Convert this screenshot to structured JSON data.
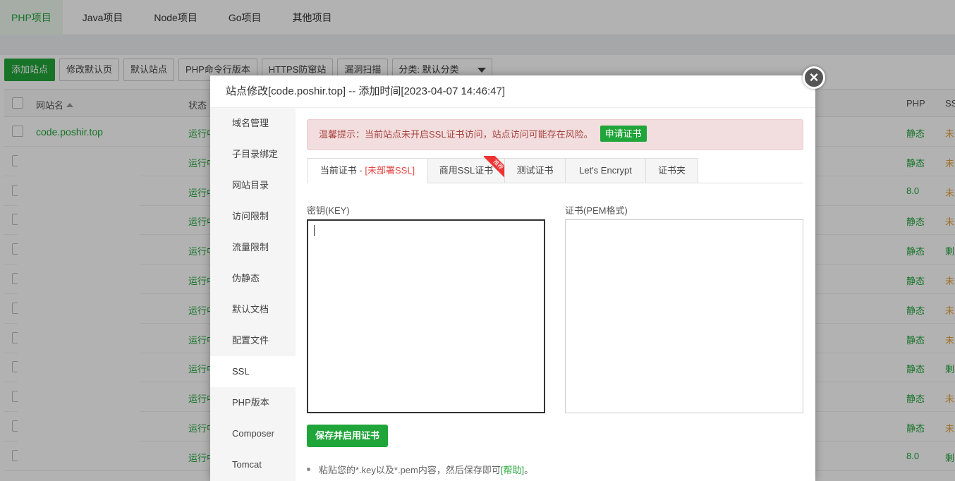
{
  "topnav": {
    "tabs": [
      "PHP项目",
      "Java项目",
      "Node项目",
      "Go项目",
      "其他项目"
    ]
  },
  "toolbar": {
    "buttons": [
      "添加站点",
      "修改默认页",
      "默认站点",
      "PHP命令行版本",
      "HTTPS防窜站",
      "漏洞扫描"
    ],
    "category_select": "分类: 默认分类"
  },
  "table": {
    "headers": {
      "name": "网站名",
      "status": "状态",
      "php": "PHP",
      "ssl": "SS"
    },
    "first_site": "code.poshir.top",
    "rows": [
      {
        "status": "运行中",
        "php": "静态",
        "ssl": "未"
      },
      {
        "status": "运行中",
        "php": "静态",
        "ssl": "未"
      },
      {
        "status": "运行中",
        "php": "8.0",
        "ssl": "未"
      },
      {
        "status": "运行中",
        "php": "静态",
        "ssl": "未"
      },
      {
        "status": "运行中",
        "php": "静态",
        "ssl": "剩"
      },
      {
        "status": "运行中",
        "php": "静态",
        "ssl": "未"
      },
      {
        "status": "运行中",
        "php": "静态",
        "ssl": "未"
      },
      {
        "status": "运行中",
        "php": "静态",
        "ssl": "未"
      },
      {
        "status": "运行中",
        "php": "静态",
        "ssl": "剩"
      },
      {
        "status": "运行中",
        "php": "静态",
        "ssl": "未"
      },
      {
        "status": "运行中",
        "php": "静态",
        "ssl": "未"
      },
      {
        "status": "运行中",
        "php": "8.0",
        "ssl": "剩"
      }
    ]
  },
  "modal": {
    "title": "站点修改[code.poshir.top] -- 添加时间[2023-04-07 14:46:47]",
    "close": "×",
    "sidebar": [
      "域名管理",
      "子目录绑定",
      "网站目录",
      "访问限制",
      "流量限制",
      "伪静态",
      "默认文档",
      "配置文件",
      "SSL",
      "PHP版本",
      "Composer",
      "Tomcat"
    ],
    "alert": {
      "text": "温馨提示：当前站点未开启SSL证书访问，站点访问可能存在风险。",
      "button": "申请证书"
    },
    "tabs": {
      "current_prefix": "当前证书 - ",
      "current_status": "[未部署SSL]",
      "commercial": "商用SSL证书",
      "ribbon": "推荐",
      "test": "测试证书",
      "letsencrypt": "Let's Encrypt",
      "folder": "证书夹"
    },
    "key_label": "密钥(KEY)",
    "cert_label": "证书(PEM格式)",
    "key_value": "",
    "cert_value": "",
    "save_button": "保存并启用证书",
    "tip_text": "粘贴您的*.key以及*.pem内容，然后保存即可",
    "tip_help": "[帮助]",
    "tip_end": "。"
  },
  "colors": {
    "accent": "#20a53a",
    "danger": "#e64545",
    "warning": "#e6a23c"
  }
}
